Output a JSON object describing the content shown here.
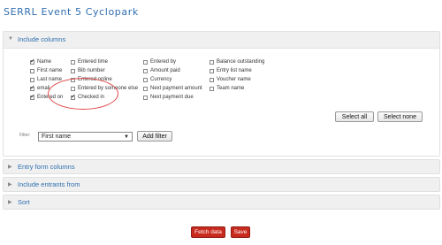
{
  "page_title": "SERRL Event 5 Cyclopark",
  "panels": {
    "include_columns": "Include columns",
    "entry_form_columns": "Entry form columns",
    "include_entrants_from": "Include entrants from",
    "sort": "Sort"
  },
  "columns": [
    [
      {
        "label": "Name",
        "checked": true
      },
      {
        "label": "First name",
        "checked": false
      },
      {
        "label": "Last name",
        "checked": false
      },
      {
        "label": "email",
        "checked": true
      },
      {
        "label": "Entered on",
        "checked": true
      }
    ],
    [
      {
        "label": "Entered time",
        "checked": false
      },
      {
        "label": "Bib number",
        "checked": false
      },
      {
        "label": "Entered online",
        "checked": false
      },
      {
        "label": "Entered by someone else",
        "checked": false
      },
      {
        "label": "Checked in",
        "checked": true
      }
    ],
    [
      {
        "label": "Entered by",
        "checked": false
      },
      {
        "label": "Amount paid",
        "checked": false
      },
      {
        "label": "Currency",
        "checked": false
      },
      {
        "label": "Next payment amount",
        "checked": false
      },
      {
        "label": "Next payment due",
        "checked": false
      }
    ],
    [
      {
        "label": "Balance outstanding",
        "checked": false
      },
      {
        "label": "Entry list name",
        "checked": false
      },
      {
        "label": "Voucher name",
        "checked": false
      },
      {
        "label": "Team name",
        "checked": false
      }
    ]
  ],
  "buttons": {
    "select_all": "Select all",
    "select_none": "Select none",
    "add_filter": "Add filter",
    "fetch_data": "Fetch data",
    "save": "Save"
  },
  "filter": {
    "label": "Filter:",
    "selected": "First name"
  }
}
